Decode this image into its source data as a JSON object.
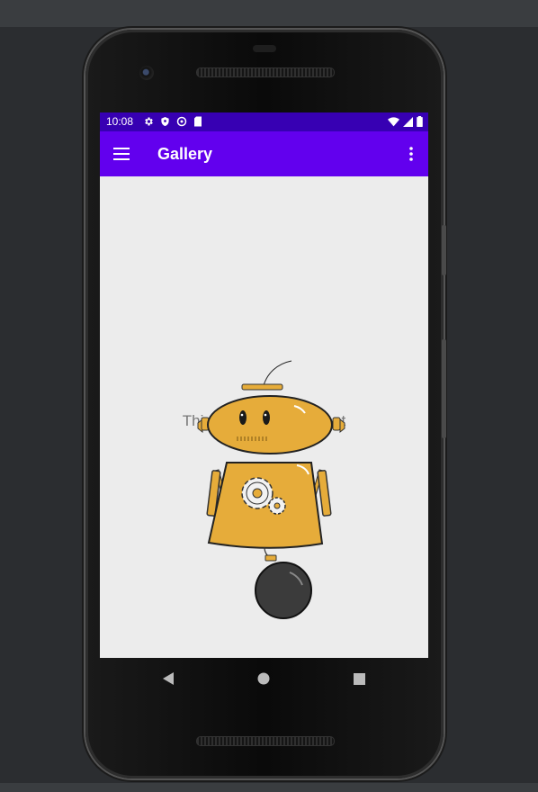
{
  "status_bar": {
    "time": "10:08",
    "left_icons": [
      "gear-icon",
      "shield-icon",
      "sync-icon",
      "sd-card-icon"
    ],
    "right_icons": [
      "wifi-icon",
      "signal-icon",
      "battery-icon"
    ]
  },
  "app_bar": {
    "title": "Gallery",
    "menu_icon": "hamburger-menu-icon",
    "overflow_icon": "more-vert-icon"
  },
  "content": {
    "fragment_text": "This is gallery Fragment"
  },
  "nav_bar": {
    "buttons": [
      "back-icon",
      "home-icon",
      "recents-icon"
    ]
  },
  "colors": {
    "status_bar": "#3700b3",
    "app_bar": "#6200ee",
    "screen_background": "#ececec",
    "robot_body": "#e6ac3a"
  }
}
